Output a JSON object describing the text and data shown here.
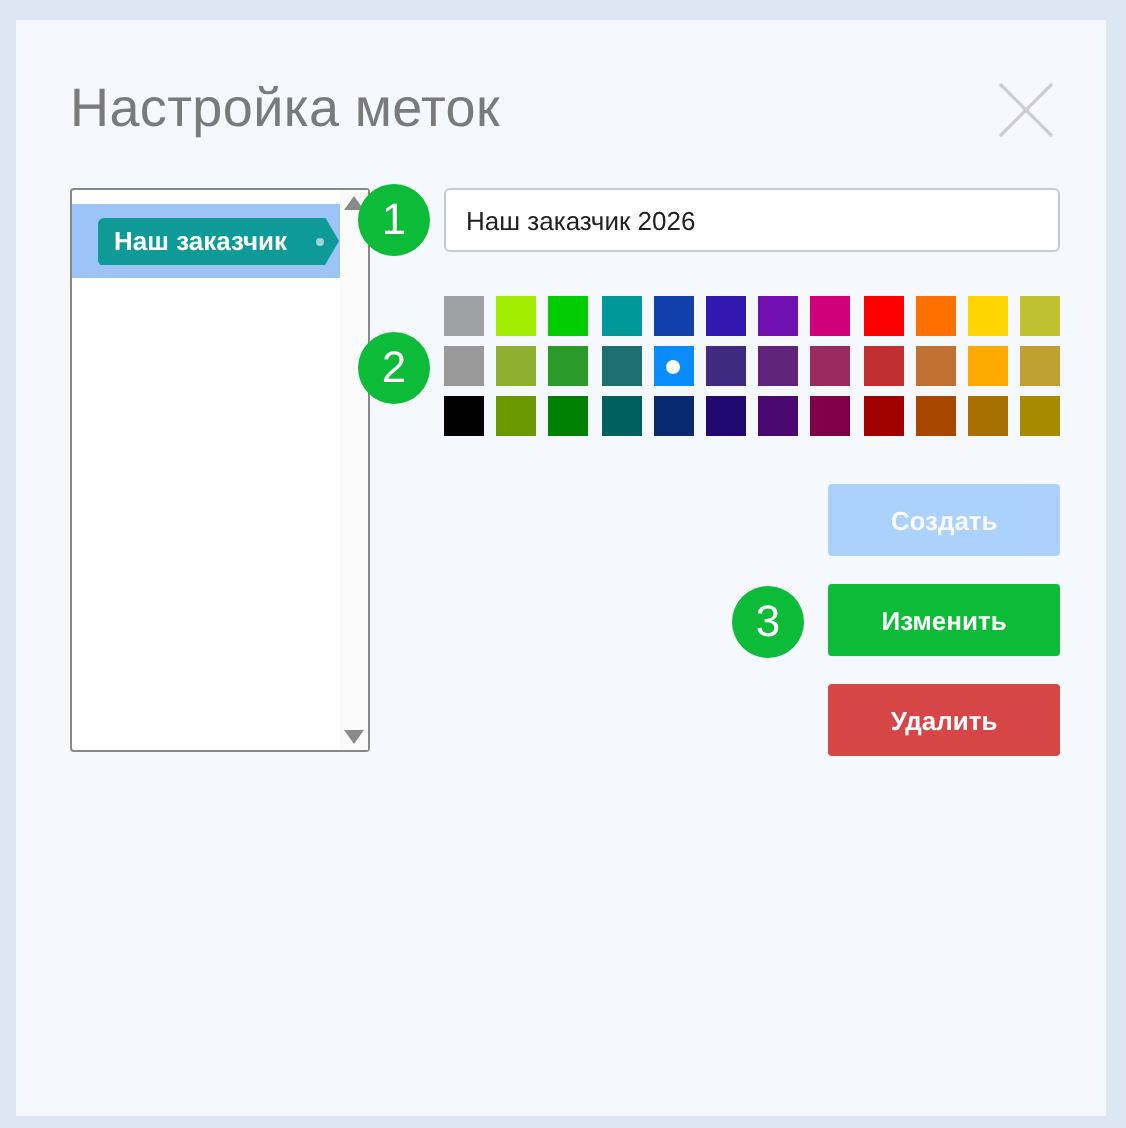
{
  "dialog": {
    "title": "Настройка меток"
  },
  "tags": [
    {
      "label": "Наш заказчик",
      "selected": true,
      "color": "#0e9a96"
    }
  ],
  "name_field": {
    "value": "Наш заказчик 2026"
  },
  "palette": [
    {
      "swatches": [
        {
          "color": "#a0a1a5",
          "selected": false
        },
        {
          "color": "#a3ee00",
          "selected": false
        },
        {
          "color": "#00cc00",
          "selected": false
        },
        {
          "color": "#009999",
          "selected": false
        },
        {
          "color": "#1040a8",
          "selected": false
        },
        {
          "color": "#3318b0",
          "selected": false
        },
        {
          "color": "#7010b0",
          "selected": false
        },
        {
          "color": "#d0007a",
          "selected": false
        },
        {
          "color": "#ff0000",
          "selected": false
        },
        {
          "color": "#ff7000",
          "selected": false
        },
        {
          "color": "#ffd500",
          "selected": false
        },
        {
          "color": "#c0c030",
          "selected": false
        }
      ]
    },
    {
      "swatches": [
        {
          "color": "#999999",
          "selected": false
        },
        {
          "color": "#8db030",
          "selected": false
        },
        {
          "color": "#2a9a2a",
          "selected": false
        },
        {
          "color": "#1e7070",
          "selected": false
        },
        {
          "color": "#0a8cff",
          "selected": true
        },
        {
          "color": "#402a80",
          "selected": false
        },
        {
          "color": "#60247a",
          "selected": false
        },
        {
          "color": "#9a2a60",
          "selected": false
        },
        {
          "color": "#c03030",
          "selected": false
        },
        {
          "color": "#c07030",
          "selected": false
        },
        {
          "color": "#ffaa00",
          "selected": false
        },
        {
          "color": "#c0a030",
          "selected": false
        }
      ]
    },
    {
      "swatches": [
        {
          "color": "#000000",
          "selected": false
        },
        {
          "color": "#6a9a00",
          "selected": false
        },
        {
          "color": "#008000",
          "selected": false
        },
        {
          "color": "#006060",
          "selected": false
        },
        {
          "color": "#082870",
          "selected": false
        },
        {
          "color": "#200870",
          "selected": false
        },
        {
          "color": "#480870",
          "selected": false
        },
        {
          "color": "#800048",
          "selected": false
        },
        {
          "color": "#a00000",
          "selected": false
        },
        {
          "color": "#a84800",
          "selected": false
        },
        {
          "color": "#a87000",
          "selected": false
        },
        {
          "color": "#a88a00",
          "selected": false
        }
      ]
    }
  ],
  "buttons": [
    {
      "label": "Создать",
      "kind": "create",
      "disabled": true
    },
    {
      "label": "Изменить",
      "kind": "edit",
      "disabled": false
    },
    {
      "label": "Удалить",
      "kind": "delete",
      "disabled": false
    }
  ],
  "callouts": [
    {
      "number": "1"
    },
    {
      "number": "2"
    },
    {
      "number": "3"
    }
  ]
}
